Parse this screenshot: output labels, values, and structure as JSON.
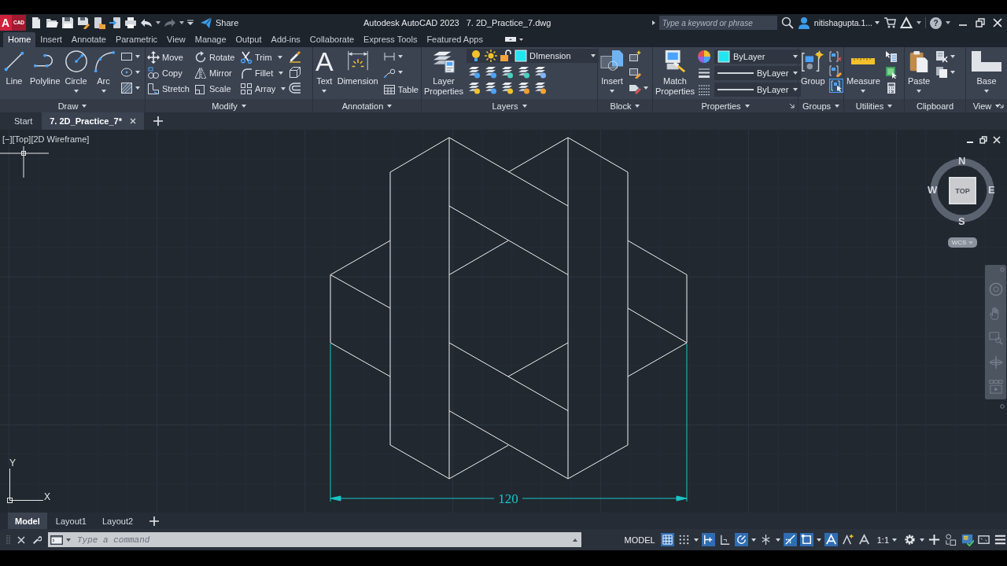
{
  "title_bar": {
    "app_letter": "A",
    "app_badge": "CAD",
    "redo": {
      "disabled": true
    },
    "share": "Share",
    "app_name": "Autodesk AutoCAD 2023",
    "file_name": "7. 2D_Practice_7.dwg",
    "search": {
      "placeholder": "Type a keyword or phrase"
    },
    "user": "nitishagupta.1...",
    "help": "?"
  },
  "ribbon_tabs": [
    {
      "label": "Home",
      "selected": true
    },
    {
      "label": "Insert",
      "selected": false
    },
    {
      "label": "Annotate",
      "selected": false
    },
    {
      "label": "Parametric",
      "selected": false
    },
    {
      "label": "View",
      "selected": false
    },
    {
      "label": "Manage",
      "selected": false
    },
    {
      "label": "Output",
      "selected": false
    },
    {
      "label": "Add-ins",
      "selected": false
    },
    {
      "label": "Collaborate",
      "selected": false
    },
    {
      "label": "Express Tools",
      "selected": false
    },
    {
      "label": "Featured Apps",
      "selected": false
    }
  ],
  "ribbon": {
    "draw": {
      "title": "Draw",
      "tools": [
        "Line",
        "Polyline",
        "Circle",
        "Arc"
      ]
    },
    "modify": {
      "title": "Modify",
      "tools": [
        "Move",
        "Rotate",
        "Trim",
        "Copy",
        "Mirror",
        "Fillet",
        "Stretch",
        "Scale",
        "Array"
      ]
    },
    "annotation": {
      "title": "Annotation",
      "text_glyph": "A",
      "tools": [
        "Text",
        "Dimension",
        "Table"
      ]
    },
    "layers": {
      "title": "Layers",
      "tools": [
        "Layer Properties"
      ],
      "current_layer": "DImension"
    },
    "block": {
      "title": "Block",
      "tools": [
        "Insert"
      ]
    },
    "properties": {
      "title": "Properties",
      "tools": [
        "Match Properties"
      ],
      "color_setting": "ByLayer",
      "lineweight": "ByLayer",
      "linetype": "ByLayer"
    },
    "groups": {
      "title": "Groups",
      "tools": [
        "Group"
      ],
      "selection_toggle": {
        "on": true
      }
    },
    "utilities": {
      "title": "Utilities",
      "tools": [
        "Measure"
      ]
    },
    "clipboard": {
      "title": "Clipboard",
      "tools": [
        "Paste"
      ]
    },
    "view": {
      "title": "View",
      "tools": [
        "Base"
      ]
    }
  },
  "file_tabs": [
    {
      "label": "Start",
      "selected": false
    },
    {
      "label": "7. 2D_Practice_7*",
      "selected": true
    }
  ],
  "viewport": {
    "controls": [
      "[−]",
      "[Top]",
      "[2D Wireframe]"
    ],
    "view_cube": {
      "north": "N",
      "east": "E",
      "south": "S",
      "west": "W",
      "face": "TOP",
      "coordinate_system": "WCS"
    },
    "dimension": "120",
    "ucs": {
      "y": "Y",
      "x": "X"
    }
  },
  "layout_tabs": [
    {
      "label": "Model",
      "selected": true
    },
    {
      "label": "Layout1",
      "selected": false
    },
    {
      "label": "Layout2",
      "selected": false
    }
  ],
  "command_line": {
    "placeholder": "Type a command"
  },
  "status_bar": {
    "space": "MODEL",
    "toggles": [
      {
        "on": true
      },
      {
        "on": false
      },
      {
        "on": true
      },
      {
        "on": false
      },
      {
        "on": true
      },
      {
        "on": false
      },
      {
        "on": true
      },
      {
        "on": true
      },
      {
        "on": true
      },
      {
        "on": false
      }
    ],
    "scale": "1:1"
  }
}
